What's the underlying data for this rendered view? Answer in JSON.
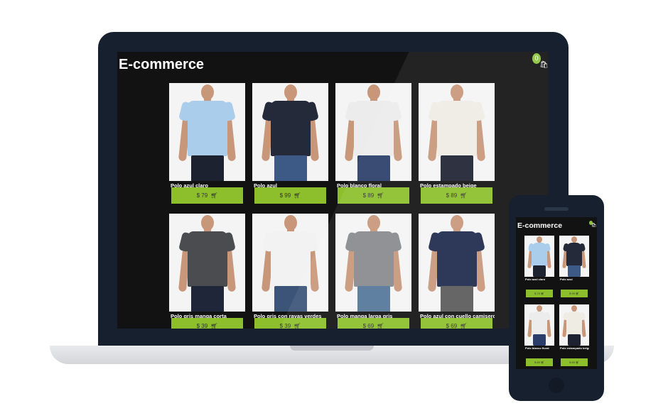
{
  "desktop": {
    "app_title": "E-commerce",
    "cart_count": "0",
    "cart_icon": "shopping-bag-icon",
    "buy_icon": "cart-icon",
    "products": [
      {
        "name": "Polo azul claro",
        "price": "$ 79",
        "shirt_color": "#a9cdea",
        "pants_color": "#1d2230"
      },
      {
        "name": "Polo azul",
        "price": "$ 99",
        "shirt_color": "#252a3a",
        "pants_color": "#3c5a85"
      },
      {
        "name": "Polo blanco floral",
        "price": "$ 89",
        "shirt_color": "#ececec",
        "pants_color": "#2b3d6a"
      },
      {
        "name": "Polo estampado beige",
        "price": "$ 89",
        "shirt_color": "#efece4",
        "pants_color": "#1f2331"
      },
      {
        "name": "Polo gris manga corta",
        "price": "$ 39",
        "shirt_color": "#4a4c50",
        "pants_color": "#20263a"
      },
      {
        "name": "Polo gris con rayas verdes",
        "price": "$ 39",
        "shirt_color": "#f2f2f2",
        "pants_color": "#3b5478"
      },
      {
        "name": "Polo manga larga gris",
        "price": "$ 69",
        "shirt_color": "#888a8d",
        "pants_color": "#55779a"
      },
      {
        "name": "Polo azul con cuello camisero",
        "price": "$ 69",
        "shirt_color": "#1e2a4d",
        "pants_color": "#5a5a5a"
      }
    ]
  },
  "mobile": {
    "app_title": "E-commerce",
    "products": [
      {
        "name": "Polo azul claro",
        "price": "$ 79",
        "shirt_color": "#a9cdea",
        "pants_color": "#1d2230"
      },
      {
        "name": "Polo azul",
        "price": "$ 99",
        "shirt_color": "#252a3a",
        "pants_color": "#3c5a85"
      },
      {
        "name": "Polo blanco floral",
        "price": "$ 89",
        "shirt_color": "#ececec",
        "pants_color": "#2b3d6a"
      },
      {
        "name": "Polo estampado beige",
        "price": "$ 89",
        "shirt_color": "#efece4",
        "pants_color": "#1f2331"
      }
    ]
  },
  "colors": {
    "accent": "#8cbf2b",
    "screen_bg": "#121212",
    "device_frame": "#16202e"
  }
}
